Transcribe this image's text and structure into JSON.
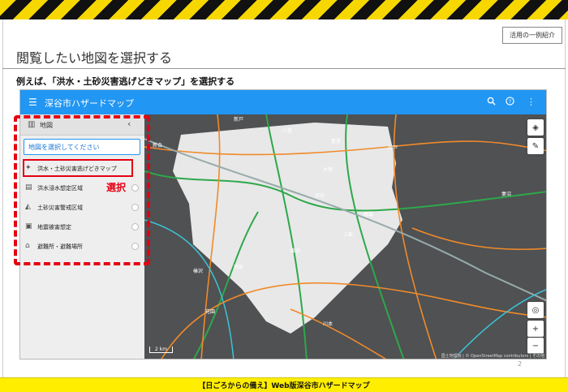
{
  "slide": {
    "usage_button": "活用の一例紹介",
    "title": "閲覧したい地図を選択する",
    "instruction": "例えば、「洪水・土砂災害逃げどきマップ」を選択する",
    "annotation_label": "選択",
    "page_number": "2",
    "footer": "【日ごろからの備え】Web版深谷市ハザードマップ"
  },
  "app": {
    "title": "深谷市ハザードマップ",
    "appbar_icons": [
      "menu-icon",
      "search-icon",
      "help-icon",
      "more-vert-icon"
    ],
    "brand_color": "#2196f3",
    "panel": {
      "header": "地図",
      "select_placeholder": "地図を選択してください",
      "options": [
        {
          "label": "洪水・土砂災害逃げどきマップ",
          "icon": "person-running-icon",
          "highlighted": true
        },
        {
          "label": "洪水浸水想定区域",
          "icon": "flood-icon",
          "highlighted": false
        },
        {
          "label": "土砂災害警戒区域",
          "icon": "landslide-icon",
          "highlighted": false
        },
        {
          "label": "地震被害想定",
          "icon": "earthquake-icon",
          "highlighted": false
        },
        {
          "label": "避難所・避難場所",
          "icon": "shelter-icon",
          "highlighted": false
        }
      ]
    },
    "map": {
      "scale_label": "2 km",
      "attribution": "国土地理院 | © OpenStreetMap contributors | その他",
      "place_labels": [
        "八基",
        "深谷",
        "上柴",
        "藤沢",
        "岡部",
        "榛沢",
        "花園",
        "川本",
        "明戸",
        "大寄",
        "幡羅",
        "豊里",
        "新戸",
        "新会",
        "妻沼"
      ],
      "controls": [
        "layers-icon",
        "edit-icon",
        "locate-icon",
        "zoom-in-icon",
        "zoom-out-icon"
      ]
    }
  },
  "colors": {
    "annotation_red": "#e50012",
    "footer_yellow": "#ffee00",
    "hazard_yellow": "#f6d800"
  }
}
